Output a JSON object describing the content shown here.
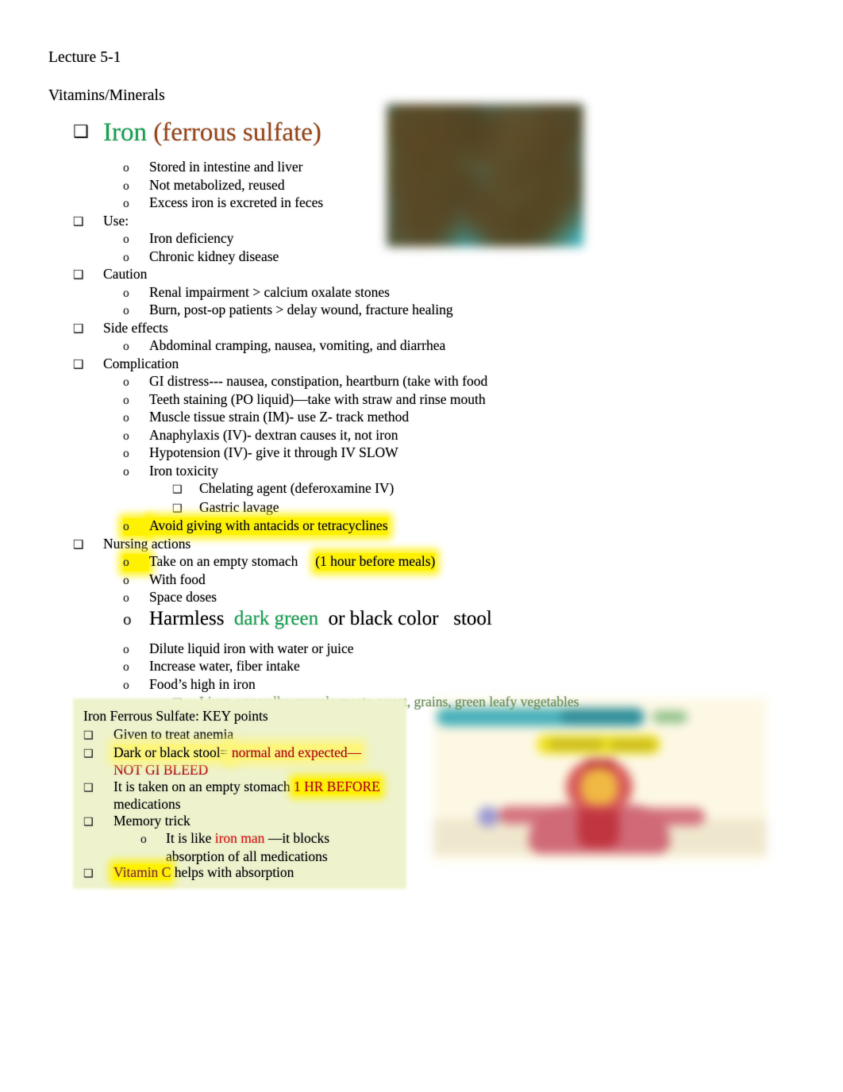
{
  "document": {
    "lecture_title": "Lecture 5-1",
    "section_title": "Vitamins/Minerals"
  },
  "colors": {
    "iron_green": "#12A452",
    "ferrous_brown": "#9A4617",
    "olive_green": "#6A9454",
    "highlight_yellow": "#FFF200",
    "red": "#C00000",
    "bright_red": "#E8100C",
    "vitamin_c_brown": "#8B2B16",
    "key_box_background": "#EEF3CD",
    "page_background": "#FFFFFF"
  },
  "outline": {
    "bullet_glyph_level1": "❑",
    "bullet_glyph_level2": "o",
    "bullet_glyph_level3": "❑",
    "iron_heading": {
      "name": "Iron",
      "parenthetical": "(ferrous sulfate)"
    },
    "iron_facts": [
      "Stored in intestine and liver",
      "Not metabolized, reused",
      "Excess iron is excreted in feces"
    ],
    "use_label": "Use:",
    "use_items": [
      "Iron deficiency",
      "Chronic kidney disease"
    ],
    "caution_label": "Caution",
    "caution_items": [
      "Renal impairment > calcium oxalate stones",
      "Burn, post-op patients > delay wound, fracture healing"
    ],
    "side_effects_label": "Side effects",
    "side_effects_items": [
      "Abdominal cramping, nausea, vomiting, and diarrhea"
    ],
    "complication_label": "Complication",
    "complication_items": [
      "GI distress--- nausea, constipation, heartburn (take with food",
      "Teeth staining (PO liquid)—take with straw and rinse mouth",
      "Muscle tissue strain (IM)- use Z- track method",
      "Anaphylaxis (IV)- dextran causes it, not iron",
      "Hypotension (IV)- give it through IV SLOW",
      "Iron toxicity"
    ],
    "iron_toxicity_subitems": [
      "Chelating agent (deferoxamine IV)",
      "Gastric lavage"
    ],
    "avoid_antacids_highlighted": "Avoid giving with antacids or tetracyclines",
    "nursing_actions_label": "Nursing actions",
    "nursing_take_empty_stomach": "Take on an empty stomach",
    "nursing_one_hour_note": "(1 hour before meals)",
    "nursing_items": [
      "With food",
      "Space doses"
    ],
    "harmless_line": {
      "part1": "Harmless",
      "part2_green": "dark green",
      "part3": "or black color",
      "part4": "stool"
    },
    "nursing_items2": [
      "Dilute liquid iron with water or juice",
      "Increase water, fiber intake",
      "Food’s high in iron"
    ],
    "foods_high_in_iron": "Liver, egg yolks, muscle meats, yeast, grains, green leafy vegetables"
  },
  "key_points_box": {
    "title": "Iron Ferrous Sulfate: KEY points",
    "item1": "Given to treat anemia",
    "item2_black": "Dark or black stool=",
    "item2_red": "normal and expected—",
    "item2_red_line2": "NOT GI BLEED",
    "item3_black": "It is taken on an empty stomach",
    "item3_red_highlight": "1 HR BEFORE",
    "item3_line2": "medications",
    "item4": "Memory trick",
    "item4_sub_pre": "It is like",
    "item4_sub_red": "iron man",
    "item4_sub_post": "—it blocks",
    "item4_sub_line2": "absorption of all medications",
    "item5_red": "Vitamin C",
    "item5_black": "helps with absorption"
  },
  "images": {
    "iron_tablets": "iron-tablets-photo",
    "iron_man_meme": "iron-man-meme-photo"
  }
}
